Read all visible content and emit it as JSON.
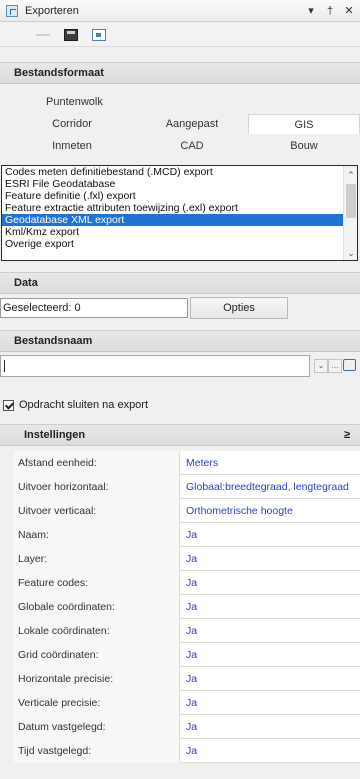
{
  "window": {
    "title": "Exporteren",
    "pin_glyph": "▾",
    "dock_glyph": "†",
    "close_glyph": "✕"
  },
  "format": {
    "header": "Bestandsformaat",
    "group_label": "Puntenwolk",
    "tabs_row1": [
      "Corridor",
      "Aangepast",
      "GIS"
    ],
    "tabs_row2": [
      "Inmeten",
      "CAD",
      "Bouw"
    ],
    "active_tab": "GIS",
    "export_list": [
      "Codes meten definitiebestand (.MCD) export",
      "ESRI File Geodatabase",
      "Feature definitie (.fxl) export",
      "Feature extractie attributen toewijzing (.exl) export",
      "Geodatabase XML export",
      "Kml/Kmz export",
      "Overige export"
    ],
    "selected_item": "Geodatabase XML export"
  },
  "data": {
    "header": "Data",
    "selected_text": "Geselecteerd: 0",
    "options_button": "Opties"
  },
  "file": {
    "header": "Bestandsnaam",
    "value": ""
  },
  "close_after_export": {
    "label": "Opdracht sluiten na export",
    "checked": true
  },
  "settings": {
    "header": "Instellingen",
    "collapse_glyph": "≥",
    "rows": [
      {
        "label": "Afstand eenheid:",
        "value": "Meters"
      },
      {
        "label": "Uitvoer horizontaal:",
        "value": "Globaal:breedtegraad, lengtegraad"
      },
      {
        "label": "Uitvoer verticaal:",
        "value": "Orthometrische hoogte"
      },
      {
        "label": "Naam:",
        "value": "Ja"
      },
      {
        "label": "Layer:",
        "value": "Ja"
      },
      {
        "label": "Feature codes:",
        "value": "Ja"
      },
      {
        "label": "Globale coördinaten:",
        "value": "Ja"
      },
      {
        "label": "Lokale coördinaten:",
        "value": "Ja"
      },
      {
        "label": "Grid coördinaten:",
        "value": "Ja"
      },
      {
        "label": "Horizontale precisie:",
        "value": "Ja"
      },
      {
        "label": "Verticale precisie:",
        "value": "Ja"
      },
      {
        "label": "Datum vastgelegd:",
        "value": "Ja"
      },
      {
        "label": "Tijd vastgelegd:",
        "value": "Ja"
      }
    ]
  },
  "colors": {
    "selection": "#1e73d6",
    "value_text": "#2a3fc2"
  }
}
